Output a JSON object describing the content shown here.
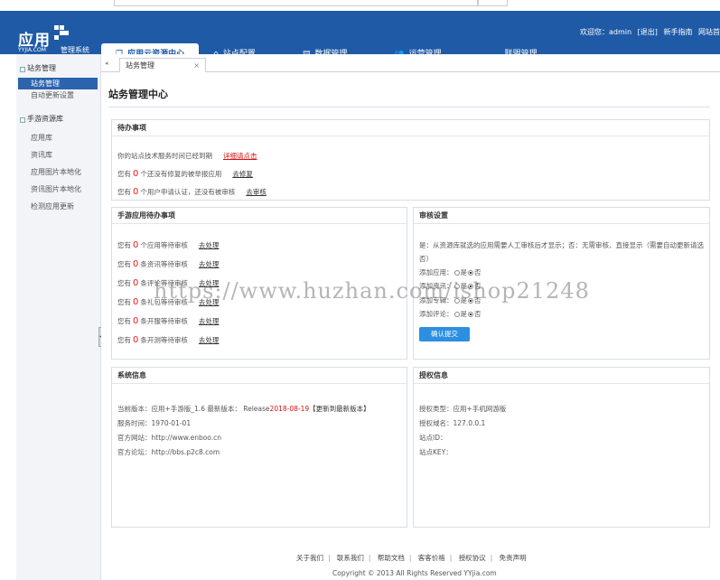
{
  "header": {
    "logo_text": "应用",
    "logo_sub": "YYJIA.COM",
    "system_name": "管理系统",
    "nav": [
      {
        "label": "应用云资源中心",
        "icon": "window-icon"
      },
      {
        "label": "站点配置",
        "icon": "home-icon"
      },
      {
        "label": "数据管理",
        "icon": "list-icon"
      },
      {
        "label": "运营管理",
        "icon": "users-icon"
      },
      {
        "label": "联盟管理",
        "icon": ""
      }
    ],
    "user": {
      "welcome": "欢迎您：admin",
      "logout": "[退出]",
      "guide": "新手指南",
      "site": "网站首"
    }
  },
  "sidebar": {
    "groups": [
      {
        "title": "站务管理",
        "items": [
          "站务管理",
          "自动更新设置"
        ]
      },
      {
        "title": "手游资源库",
        "items": [
          "应用库",
          "资讯库",
          "应用图片本地化",
          "资讯图片本地化",
          "检测应用更新"
        ]
      }
    ]
  },
  "tabs": {
    "current": "站务管理",
    "close": "×"
  },
  "page_title": "站务管理中心",
  "todo": {
    "title": "待办事项",
    "line1": "你的站点技术服务时间已经到期",
    "line1_link": "详细请点击",
    "line2_pre": "您有",
    "line2_num": "0",
    "line2_post": "个还没有修复的被举报应用",
    "line2_link": "去修复",
    "line3_pre": "您有",
    "line3_num": "0",
    "line3_post": "个用户申请认证，还没有被审核",
    "line3_link": "去审核"
  },
  "mobile_todo": {
    "title": "手游应用待办事项",
    "items": [
      {
        "pre": "您有",
        "num": "0",
        "post": "个应用等待审核",
        "link": "去处理"
      },
      {
        "pre": "您有",
        "num": "0",
        "post": "条资讯等待审核",
        "link": "去处理"
      },
      {
        "pre": "您有",
        "num": "0",
        "post": "条评论等待审核",
        "link": "去处理"
      },
      {
        "pre": "您有",
        "num": "0",
        "post": "条礼包等待审核",
        "link": "去处理"
      },
      {
        "pre": "您有",
        "num": "0",
        "post": "条开服等待审核",
        "link": "去处理"
      },
      {
        "pre": "您有",
        "num": "0",
        "post": "条开测等待审核",
        "link": "去处理"
      }
    ]
  },
  "review": {
    "title": "审核设置",
    "desc1": "是：从资源库就选的应用需要人工审核后才显示；否：无需审核、直接显示（需要自动更新请选",
    "desc2": "否）",
    "rows": [
      {
        "label": "添加应用：",
        "yes": "是",
        "no": "否"
      },
      {
        "label": "添加资讯：",
        "yes": "是",
        "no": "否"
      },
      {
        "label": "添加专辑：",
        "yes": "是",
        "no": "否"
      },
      {
        "label": "添加评论：",
        "yes": "是",
        "no": "否"
      }
    ],
    "submit": "确认提交"
  },
  "sysinfo": {
    "title": "系统信息",
    "version_pre": "当前版本：应用+手游版_1.6 最新版本： Release",
    "version_date": "2018-08-19",
    "version_link": "【更新到最新版本】",
    "service_time": "服务时间：1970-01-01",
    "site": "官方网站：http://www.enboo.cn",
    "forum": "官方论坛：http://bbs.p2c8.com"
  },
  "license": {
    "title": "授权信息",
    "type": "授权类型：应用+手机网游版",
    "domain": "授权域名：127.0.0.1",
    "site_id": "站点ID：",
    "site_key": "站点KEY："
  },
  "footer": {
    "links": [
      "关于我们",
      "联系我们",
      "帮助文档",
      "客客价格",
      "授权协议",
      "免责声明"
    ],
    "copyright": "Copyright © 2013 All Rights Reserved YYjia.com"
  },
  "watermark": "https://www.huzhan.com/ishop21248"
}
